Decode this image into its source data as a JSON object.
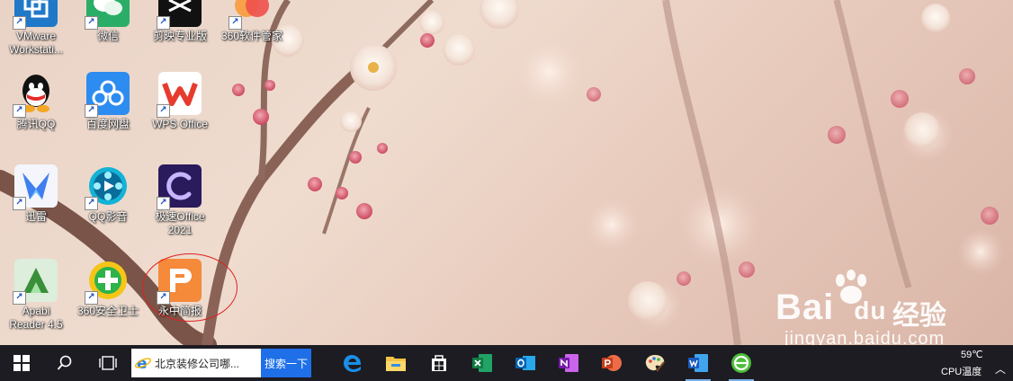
{
  "desktop": {
    "icons": [
      {
        "label": "VMware\nWorkstati...",
        "icon": "vmware-icon",
        "color": "#1f78c8"
      },
      {
        "label": "微信",
        "icon": "wechat-icon",
        "color": "#2aae67"
      },
      {
        "label": "剪映专业版",
        "icon": "jianying-icon",
        "color": "#111111"
      },
      {
        "label": "360软件管家",
        "icon": "360-software-icon",
        "color": "#f0504d"
      },
      {
        "label": "腾讯QQ",
        "icon": "qq-icon",
        "color": "#111111"
      },
      {
        "label": "百度网盘",
        "icon": "baidu-netdisk-icon",
        "color": "#2d8cf0"
      },
      {
        "label": "WPS Office",
        "icon": "wps-icon",
        "color": "#e63b2e"
      },
      {
        "label": "迅雷",
        "icon": "xunlei-icon",
        "color": "#2a6fe0"
      },
      {
        "label": "QQ影音",
        "icon": "qq-player-icon",
        "color": "#13b3d6"
      },
      {
        "label": "极速Office\n2021",
        "icon": "jisu-office-icon",
        "color": "#2a1b5c"
      },
      {
        "label": "Apabi\nReader 4.5",
        "icon": "apabi-icon",
        "color": "#3a8f3a"
      },
      {
        "label": "360安全卫士",
        "icon": "360-security-icon",
        "color": "#2cb34a"
      },
      {
        "label": "永中简报",
        "icon": "yozo-slides-icon",
        "color": "#f58a3a"
      }
    ]
  },
  "taskbar": {
    "search_text": "北京装修公司哪...",
    "search_button": "搜索一下",
    "apps": [
      {
        "name": "edge-icon"
      },
      {
        "name": "file-explorer-icon"
      },
      {
        "name": "store-icon"
      },
      {
        "name": "excel-icon"
      },
      {
        "name": "outlook-icon"
      },
      {
        "name": "onenote-icon"
      },
      {
        "name": "powerpoint-icon"
      },
      {
        "name": "paint-icon"
      },
      {
        "name": "word-icon"
      },
      {
        "name": "360-browser-icon"
      }
    ],
    "tray": {
      "temperature": "59℃",
      "cpu_label": "CPU温度",
      "chevron": "︿"
    }
  },
  "watermark": {
    "brand": "Bai",
    "brand_suffix": "du",
    "cn": "经验",
    "url": "jingyan.baidu.com"
  },
  "colors": {
    "taskbar": "#1c1c22",
    "accent": "#1e6fe8",
    "annotation": "#dd2222"
  }
}
